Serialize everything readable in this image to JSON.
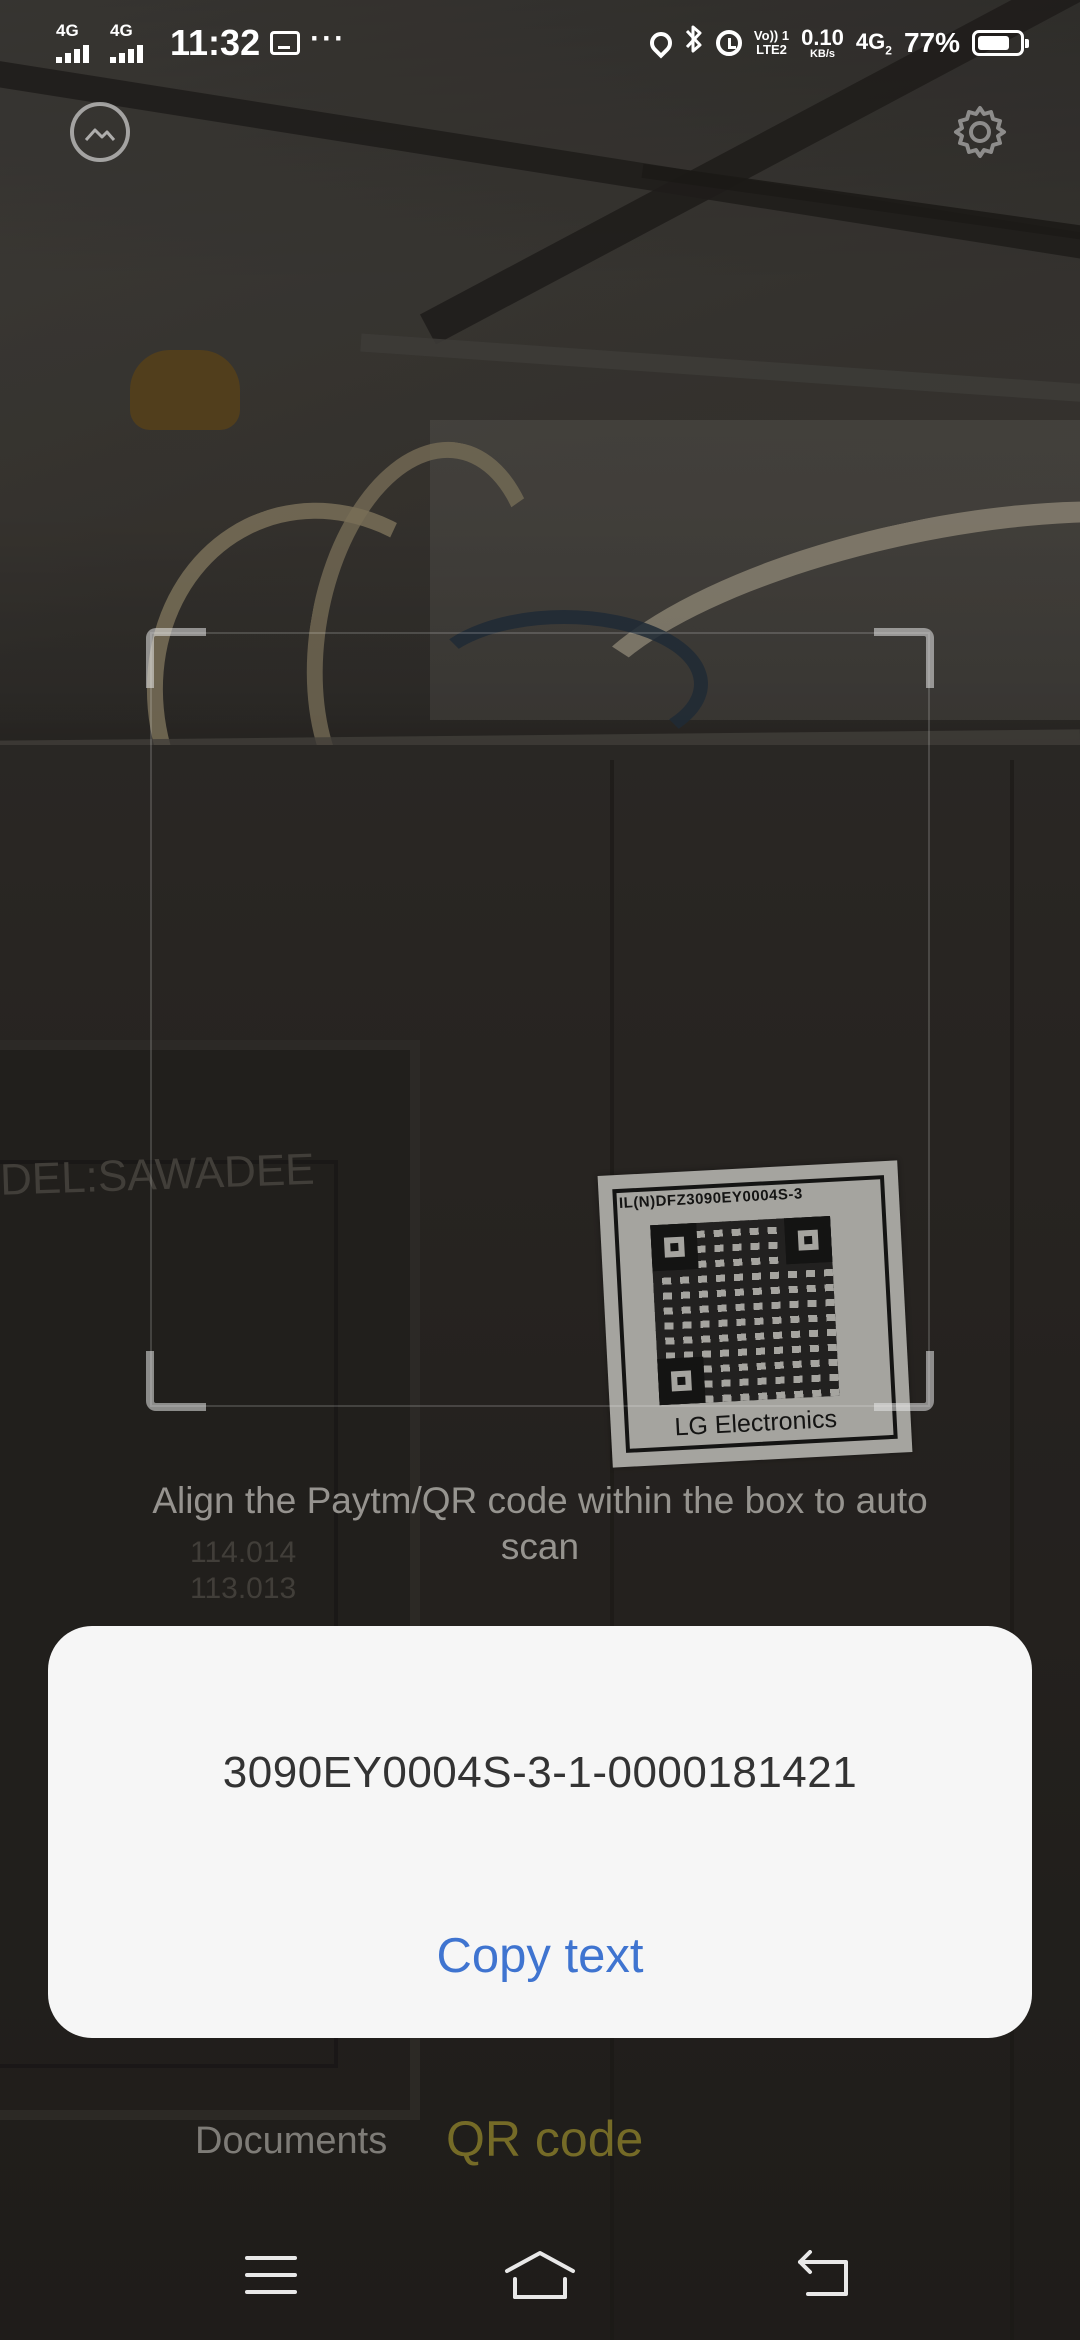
{
  "status_bar": {
    "sim1_network": "4G",
    "sim2_network": "4G",
    "time": "11:32",
    "more_indicator": "···",
    "volte_line1": "Vo)) 1",
    "volte_line2": "LTE2",
    "speed_value": "0.10",
    "speed_unit": "KB/s",
    "data_network": "4G",
    "data_network_sub": "2",
    "battery_percent": "77%",
    "battery_level": 0.77,
    "icons": [
      "signal-icon",
      "mail-icon",
      "location-icon",
      "bluetooth-icon",
      "alarm-icon",
      "battery-icon"
    ]
  },
  "toolbar": {
    "left_icon": "gallery-icon",
    "right_icon": "settings-icon"
  },
  "scanner": {
    "hint": "Align the Paytm/QR code within the box to auto scan",
    "scene_text": {
      "model_plate": "DEL:SAWADEE",
      "plate_line1": "114.014",
      "plate_line2": "113.013",
      "sticker_code": "IL(N)DFZ3090EY0004S-3",
      "sticker_brand": "LG Electronics"
    }
  },
  "result_dialog": {
    "scanned_text": "3090EY0004S-3-1-0000181421",
    "copy_label": "Copy text"
  },
  "modes": {
    "documents_label": "Documents",
    "qr_label": "QR code",
    "active": "QR code",
    "active_color": "#756b27"
  },
  "nav_bar": {
    "icons": [
      "menu-icon",
      "home-icon",
      "back-icon"
    ]
  },
  "colors": {
    "accent_link": "#3f74d0",
    "dialog_bg": "#f6f6f6"
  }
}
